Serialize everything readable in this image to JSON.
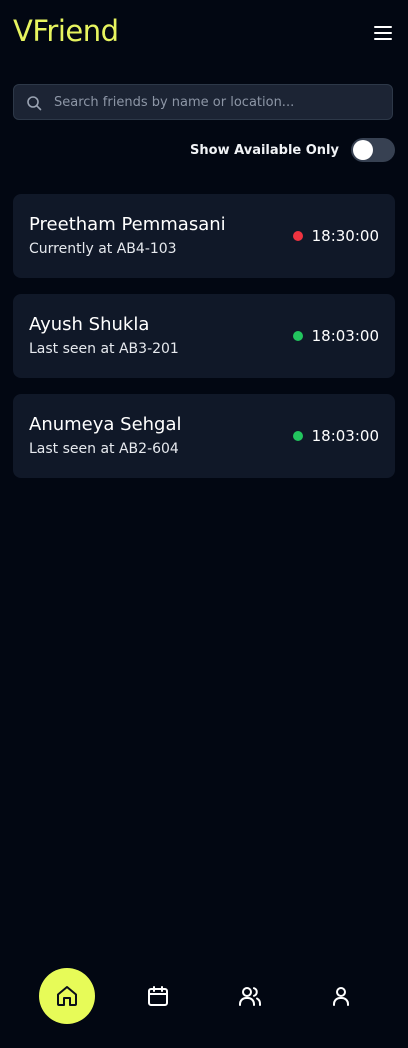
{
  "app": {
    "title": "VFriend"
  },
  "header": {
    "menu_icon": "hamburger-menu-icon"
  },
  "search": {
    "placeholder": "Search friends by name or location...",
    "value": "",
    "icon": "search-icon"
  },
  "filter": {
    "label": "Show Available Only",
    "enabled": false
  },
  "friends": [
    {
      "name": "Preetham Pemmasani",
      "location": "Currently at AB4-103",
      "time": "18:30:00",
      "status_color": "#ef3340"
    },
    {
      "name": "Ayush Shukla",
      "location": "Last seen at AB3-201",
      "time": "18:03:00",
      "status_color": "#22c55e"
    },
    {
      "name": "Anumeya Sehgal",
      "location": "Last seen at AB2-604",
      "time": "18:03:00",
      "status_color": "#22c55e"
    }
  ],
  "nav": {
    "items": [
      {
        "icon": "home-icon",
        "active": true
      },
      {
        "icon": "calendar-icon",
        "active": false
      },
      {
        "icon": "users-icon",
        "active": false
      },
      {
        "icon": "user-icon",
        "active": false
      }
    ]
  },
  "colors": {
    "background": "#020712",
    "card": "#101828",
    "accent": "#e7f45f",
    "nav_active": "#e7fb58"
  }
}
